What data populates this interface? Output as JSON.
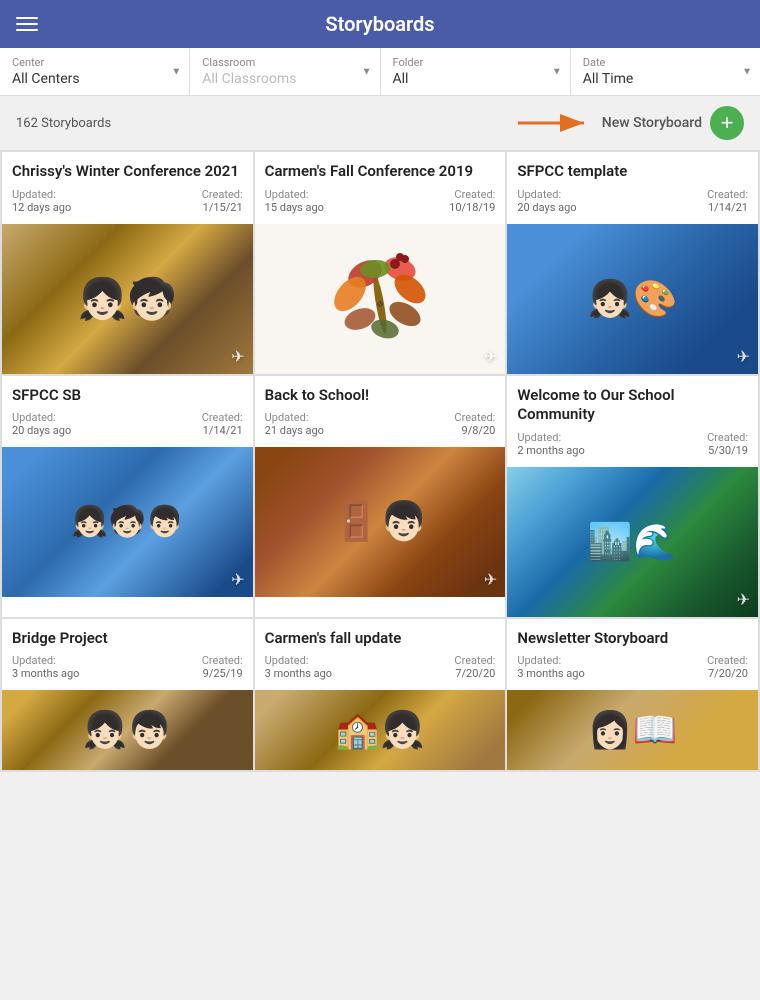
{
  "header": {
    "title": "Storyboards",
    "menu_icon": "hamburger"
  },
  "filters": [
    {
      "label": "Center",
      "value": "All Centers"
    },
    {
      "label": "Classroom",
      "value": "All Classrooms",
      "placeholder": true
    },
    {
      "label": "Folder",
      "value": "All"
    },
    {
      "label": "Date",
      "value": "All Time"
    }
  ],
  "action_bar": {
    "count": "162 Storyboards",
    "new_label": "New Storyboard",
    "new_btn_symbol": "+"
  },
  "cards": [
    {
      "id": "chrissy",
      "title": "Chrissy's Winter Conference 2021",
      "updated_label": "Updated:",
      "updated_value": "12 days ago",
      "created_label": "Created:",
      "created_value": "1/15/21",
      "img_class": "img-chrissy"
    },
    {
      "id": "carmen-fall",
      "title": "Carmen's Fall Conference 2019",
      "updated_label": "Updated:",
      "updated_value": "15 days ago",
      "created_label": "Created:",
      "created_value": "10/18/19",
      "img_class": "img-carmen-fall"
    },
    {
      "id": "sfpcc-template",
      "title": "SFPCC template",
      "updated_label": "Updated:",
      "updated_value": "20 days ago",
      "created_label": "Created:",
      "created_value": "1/14/21",
      "img_class": "img-sfpcc"
    },
    {
      "id": "sfpcc-sb",
      "title": "SFPCC SB",
      "updated_label": "Updated:",
      "updated_value": "20 days ago",
      "created_label": "Created:",
      "created_value": "1/14/21",
      "img_class": "img-sfpcc-sb"
    },
    {
      "id": "back-school",
      "title": "Back to School!",
      "updated_label": "Updated:",
      "updated_value": "21 days ago",
      "created_label": "Created:",
      "created_value": "9/8/20",
      "img_class": "img-back-school"
    },
    {
      "id": "welcome",
      "title": "Welcome to Our School Community",
      "updated_label": "Updated:",
      "updated_value": "2 months ago",
      "created_label": "Created:",
      "created_value": "5/30/19",
      "img_class": "img-welcome"
    },
    {
      "id": "bridge",
      "title": "Bridge Project",
      "updated_label": "Updated:",
      "updated_value": "3 months ago",
      "created_label": "Created:",
      "created_value": "9/25/19",
      "img_class": "img-bridge"
    },
    {
      "id": "carmen-update",
      "title": "Carmen's fall update",
      "updated_label": "Updated:",
      "updated_value": "3 months ago",
      "created_label": "Created:",
      "created_value": "7/20/20",
      "img_class": "img-carmen-update"
    },
    {
      "id": "newsletter",
      "title": "Newsletter Storyboard",
      "updated_label": "Updated:",
      "updated_value": "3 months ago",
      "created_label": "Created:",
      "created_value": "7/20/20",
      "img_class": "img-newsletter"
    }
  ]
}
